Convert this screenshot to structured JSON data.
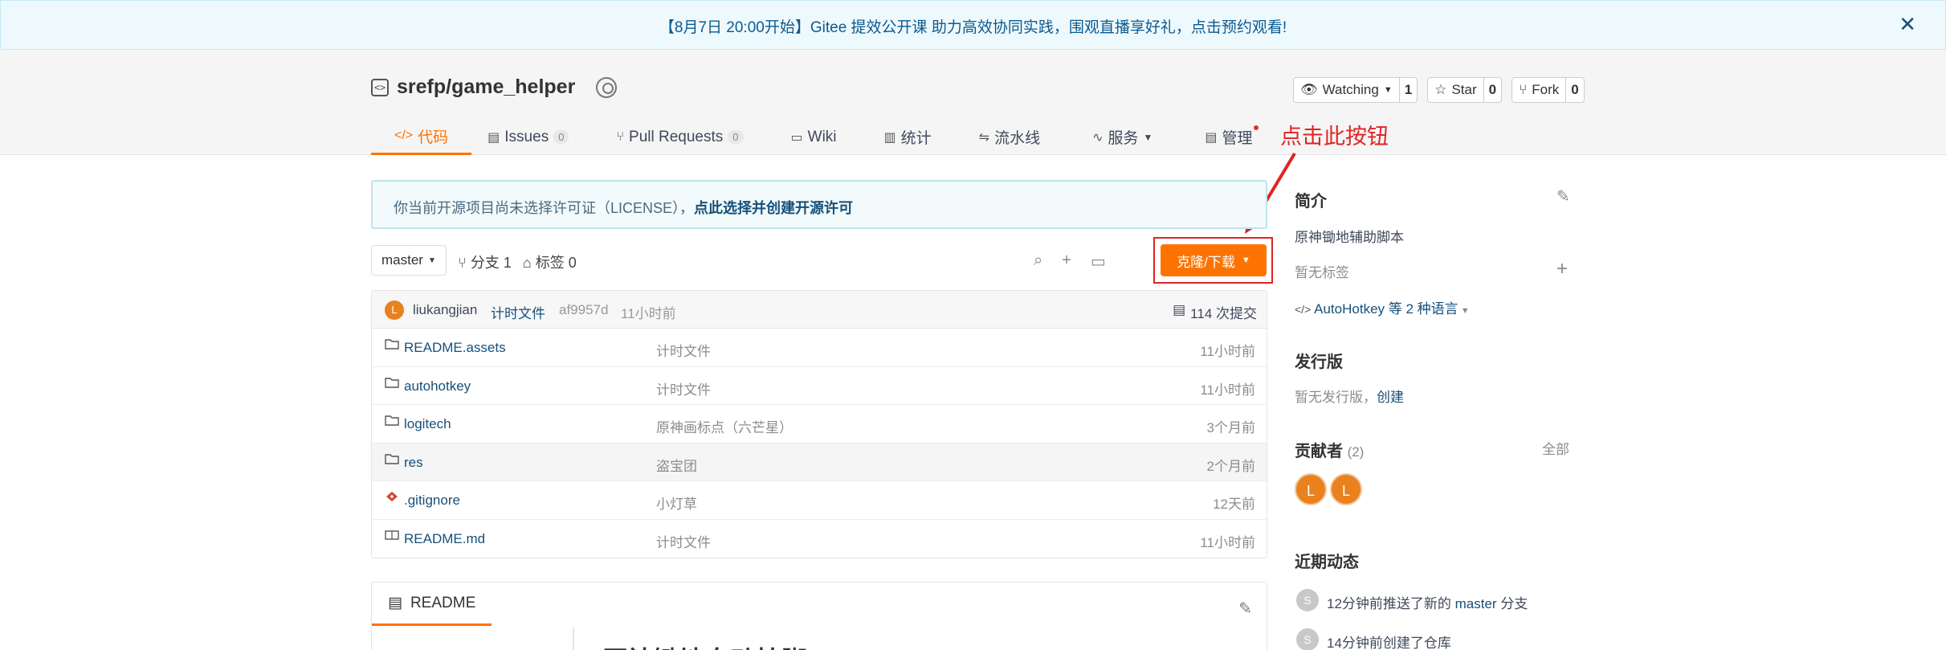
{
  "banner": {
    "text": "【8月7日 20:00开始】Gitee 提效公开课 助力高效协同实践，围观直播享好礼，点击预约观看!",
    "close_icon": "close-icon"
  },
  "repo": {
    "full_name": "srefp/game_helper",
    "actions": [
      {
        "label": "Watching",
        "count": "1",
        "icon": "eye-icon"
      },
      {
        "label": "Star",
        "count": "0",
        "icon": "star-icon"
      },
      {
        "label": "Fork",
        "count": "0",
        "icon": "fork-icon"
      }
    ]
  },
  "tabs": [
    {
      "label": "代码",
      "icon": "code-icon",
      "active": true
    },
    {
      "label": "Issues",
      "count": "0",
      "icon": "issues-icon"
    },
    {
      "label": "Pull Requests",
      "count": "0",
      "icon": "pull-request-icon"
    },
    {
      "label": "Wiki",
      "icon": "wiki-icon"
    },
    {
      "label": "统计",
      "icon": "stats-icon"
    },
    {
      "label": "流水线",
      "icon": "pipeline-icon"
    },
    {
      "label": "服务",
      "icon": "service-icon"
    },
    {
      "label": "管理",
      "icon": "manage-icon"
    }
  ],
  "annotation": {
    "text": "点击此按钮"
  },
  "license_notice": {
    "text": "你当前开源项目尚未选择许可证（LICENSE），",
    "link": "点此选择并创建开源许可"
  },
  "branch_bar": {
    "branch": "master",
    "branches": "分支 1",
    "tags": "标签 0",
    "clone_button": "克隆/下载"
  },
  "latest_commit": {
    "avatar": "L",
    "author": "liukangjian",
    "message": "计时文件",
    "hash": "af9957d",
    "time": "11小时前",
    "count": "114 次提交"
  },
  "files": [
    {
      "name": "README.assets",
      "type": "folder",
      "message": "计时文件",
      "time": "11小时前"
    },
    {
      "name": "autohotkey",
      "type": "folder",
      "message": "计时文件",
      "time": "11小时前"
    },
    {
      "name": "logitech",
      "type": "folder",
      "message": "原神画标点（六芒星）",
      "time": "3个月前"
    },
    {
      "name": "res",
      "type": "folder",
      "message": "盗宝团",
      "time": "2个月前"
    },
    {
      "name": ".gitignore",
      "type": "git",
      "message": "小灯草",
      "time": "12天前"
    },
    {
      "name": "README.md",
      "type": "readme",
      "message": "计时文件",
      "time": "11小时前"
    }
  ],
  "readme": {
    "tab_label": "README",
    "heading": "原神锄地自动挂脚"
  },
  "sidebar": {
    "intro_title": "简介",
    "intro_text": "原神锄地辅助脚本",
    "no_tags": "暂无标签",
    "languages": "AutoHotkey 等 2 种语言",
    "releases_title": "发行版",
    "releases_none": "暂无发行版，",
    "releases_create": "创建",
    "contributors_title": "贡献者",
    "contributors_count": "(2)",
    "contributors_all": "全部",
    "contributors": [
      "L",
      "L"
    ],
    "activity_title": "近期动态",
    "activities": [
      {
        "avatar": "S",
        "prefix": "12分钟前推送了新的 ",
        "link": "master",
        "suffix": " 分支"
      },
      {
        "avatar": "S",
        "prefix": "14分钟前创建了仓库",
        "link": "",
        "suffix": ""
      }
    ]
  }
}
